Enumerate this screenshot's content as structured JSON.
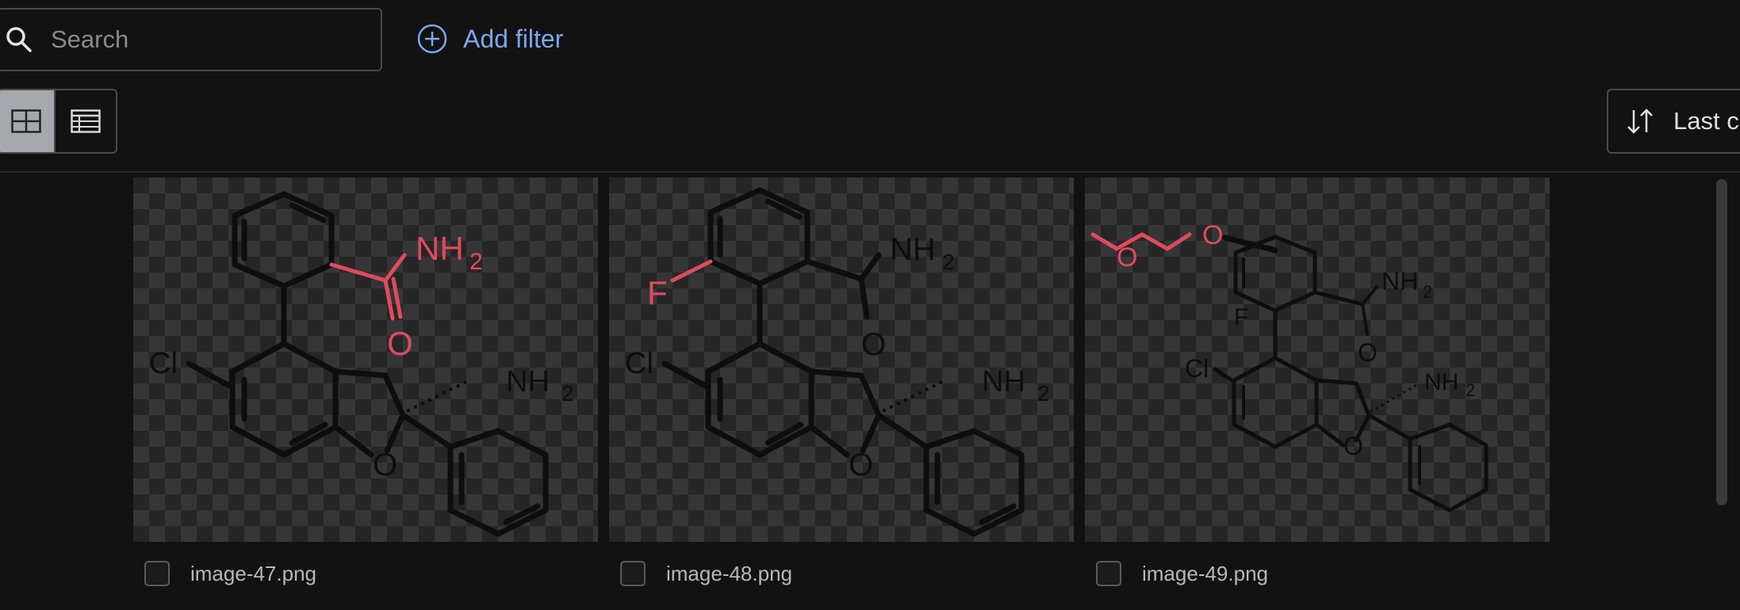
{
  "search": {
    "placeholder": "Search",
    "value": ""
  },
  "add_filter": {
    "label": "Add filter"
  },
  "view_toggle": {
    "active": "grid"
  },
  "sort": {
    "label": "Last c"
  },
  "gallery": {
    "items": [
      {
        "filename": "image-47.png",
        "labels": {
          "nh2_top": "NH",
          "nh2_top_sub": "2",
          "o_top": "O",
          "cl": "Cl",
          "nh2_side": "NH",
          "nh2_side_sub": "2",
          "o_ring": "O"
        }
      },
      {
        "filename": "image-48.png",
        "labels": {
          "f": "F",
          "nh2_top": "NH",
          "nh2_top_sub": "2",
          "o_top": "O",
          "cl": "Cl",
          "nh2_side": "NH",
          "nh2_side_sub": "2",
          "o_ring": "O"
        }
      },
      {
        "filename": "image-49.png",
        "labels": {
          "o1": "O",
          "o2": "O",
          "f": "F",
          "nh2_top": "NH",
          "nh2_top_sub": "2",
          "o_top": "O",
          "cl": "Cl",
          "nh2_side": "NH",
          "nh2_side_sub": "2",
          "o_ring": "O"
        }
      }
    ]
  },
  "colors": {
    "accent": "#7da7ef",
    "highlight": "#e04a5e",
    "background": "#121212"
  }
}
